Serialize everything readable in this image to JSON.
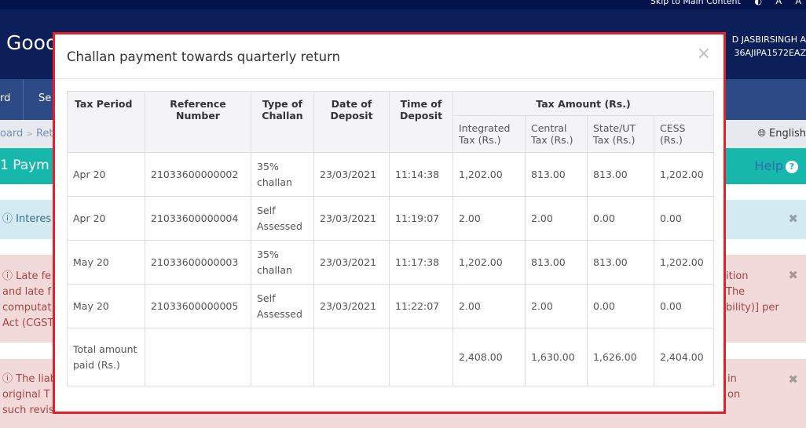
{
  "topbar": {
    "skip_link": "Skip to Main Content",
    "a_minus": "A",
    "a_plus": "A"
  },
  "header": {
    "site_title": "Goods and Services Tax",
    "user_name": "D JASBIRSINGH A",
    "gstin": "36AJIPA1572EAZ"
  },
  "nav": {
    "items": [
      "rd",
      "Se"
    ]
  },
  "breadcrumb": {
    "text": "oard",
    "separator": ">",
    "next": "Ret",
    "language": "English"
  },
  "page": {
    "title": "1 Paym",
    "help_label": "Help"
  },
  "alerts": [
    {
      "type": "info",
      "text": "Interes",
      "right_text": ""
    },
    {
      "type": "danger",
      "lines": [
        "Late fe",
        "and late f",
        "computat",
        "Act (CGST"
      ],
      "right_lines": [
        "ition",
        "The",
        "bility)] per"
      ]
    },
    {
      "type": "danger",
      "lines": [
        "The liab",
        "original T",
        "such revis"
      ],
      "right_lines": [
        "in",
        "on"
      ]
    }
  ],
  "modal": {
    "title": "Challan payment towards quarterly return",
    "close_label": "×",
    "table": {
      "headers": {
        "tax_period": "Tax Period",
        "reference_number": "Reference Number",
        "type_of_challan": "Type of Challan",
        "date_of_deposit": "Date of Deposit",
        "time_of_deposit": "Time of Deposit",
        "tax_amount": "Tax Amount (Rs.)",
        "integrated": "Integrated Tax (Rs.)",
        "central": "Central Tax (Rs.)",
        "state_ut": "State/UT Tax (Rs.)",
        "cess": "CESS (Rs.)"
      },
      "rows": [
        {
          "tax_period": "Apr 20",
          "reference": "21033600000002",
          "type": "35% challan",
          "date": "23/03/2021",
          "time": "11:14:38",
          "integrated": "1,202.00",
          "central": "813.00",
          "state_ut": "813.00",
          "cess": "1,202.00"
        },
        {
          "tax_period": "Apr 20",
          "reference": "21033600000004",
          "type": "Self Assessed",
          "date": "23/03/2021",
          "time": "11:19:07",
          "integrated": "2.00",
          "central": "2.00",
          "state_ut": "0.00",
          "cess": "0.00"
        },
        {
          "tax_period": "May 20",
          "reference": "21033600000003",
          "type": "35% challan",
          "date": "23/03/2021",
          "time": "11:17:38",
          "integrated": "1,202.00",
          "central": "813.00",
          "state_ut": "813.00",
          "cess": "1,202.00"
        },
        {
          "tax_period": "May 20",
          "reference": "21033600000005",
          "type": "Self Assessed",
          "date": "23/03/2021",
          "time": "11:22:07",
          "integrated": "2.00",
          "central": "2.00",
          "state_ut": "0.00",
          "cess": "0.00"
        }
      ],
      "total": {
        "label": "Total amount paid (Rs.)",
        "integrated": "2,408.00",
        "central": "1,630.00",
        "state_ut": "1,626.00",
        "cess": "2,404.00"
      }
    }
  },
  "colors": {
    "modal_border": "#e2222a",
    "header_bg": "#0c1f59",
    "nav_bg": "#2c4a86",
    "teal_bar": "#17b8ab",
    "danger_bg": "#f2dadb",
    "info_bg": "#d3eaf3"
  }
}
